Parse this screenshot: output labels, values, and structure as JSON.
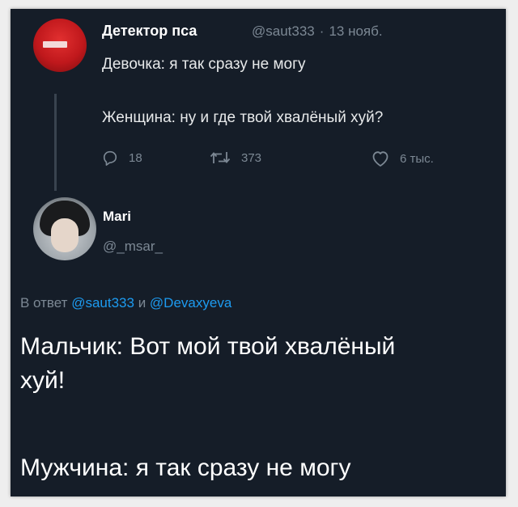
{
  "tweet": {
    "author_name": "Детектор пса",
    "author_handle": "@saut333",
    "separator": "·",
    "date": "13 нояб.",
    "line1": "Девочка: я так сразу не могу",
    "line2": "Женщина: ну и где твой хвалёный хуй?",
    "reply_count": "18",
    "retweet_count": "373",
    "like_count": "6 тыс."
  },
  "reply": {
    "author_name": "Mari",
    "author_handle": "@_msar_",
    "reply_prefix": "В ответ",
    "reply_to_1": "@saut333",
    "reply_joiner": "и",
    "reply_to_2": "@Devaxyeva",
    "text_line1": "Мальчик: Вот мой твой хвалёный",
    "text_line2": "хуй!",
    "text_line3": "Мужчина: я так сразу не могу"
  },
  "icons": [
    "reply-icon",
    "retweet-icon",
    "like-icon"
  ],
  "colors": {
    "background": "#151d28",
    "text": "#e7e9ea",
    "muted": "#7c8894",
    "link": "#1d9bf0"
  }
}
